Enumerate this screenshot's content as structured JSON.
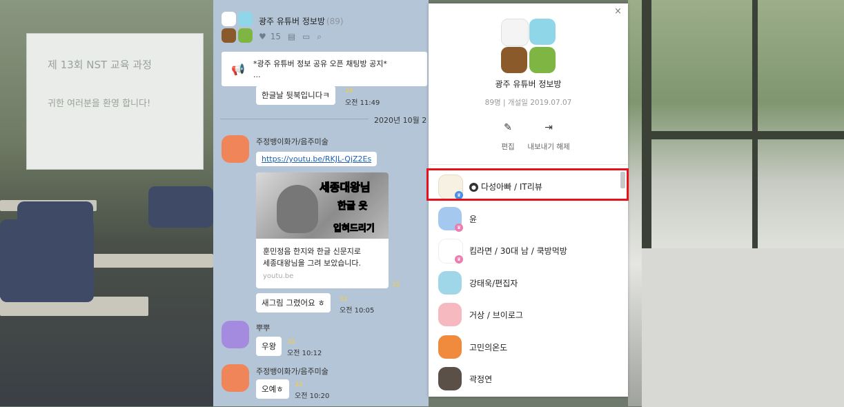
{
  "chat": {
    "room_title": "광주 유튜버 정보방",
    "room_count": "(89)",
    "likes": "15",
    "notice_text": "*광주 유튜버 정보 공유 오픈 채팅방 공지*",
    "notice_more": "...",
    "msg_prev": {
      "text": "한글날 뒷북입니다ㅋ",
      "unread": "24",
      "time": "오전 11:49"
    },
    "date_divider": "2020년 10월 2",
    "msg_link": {
      "sender": "주정뱅이화가/음주미술",
      "url": "https://youtu.be/RKJL-QjZ2Es"
    },
    "card": {
      "img_line1": "세종대왕님",
      "img_line2": "한글 옷",
      "img_line3": "입혀드리기",
      "desc_line1": "훈민정음 한지와 한글 신문지로",
      "desc_line2": "세종대왕님을 그려 보았습니다.",
      "source": "youtu.be",
      "unread": "32"
    },
    "msg_reply": {
      "text": "새그림 그렸어요 ㅎ",
      "unread": "32",
      "time": "오전 10:05"
    },
    "msg_bubu": {
      "sender": "뿌뿌",
      "text": "우왕",
      "unread": "32",
      "time": "오전 10:12"
    },
    "msg_last": {
      "sender": "주정뱅이화가/음주미술",
      "text": "오예ㅎ",
      "unread": "32",
      "time": "오전 10:20"
    }
  },
  "panel": {
    "close": "×",
    "title": "광주 유튜버 정보방",
    "sub": "89명 | 개설일 2019.07.07",
    "action_edit": "편집",
    "action_unpin": "내보내기 해제",
    "members": [
      {
        "name": "다성아빠 / IT리뷰",
        "host": true
      },
      {
        "name": "윤",
        "host": false
      },
      {
        "name": "킴라면 / 30대 남 / 쿡방먹방",
        "host": false
      },
      {
        "name": "강태욱/편집자",
        "host": false
      },
      {
        "name": "거상 / 브이로그",
        "host": false
      },
      {
        "name": "고민의온도",
        "host": false
      },
      {
        "name": "곽정연",
        "host": false
      }
    ]
  },
  "background": {
    "screen_title": "제 13회 NST 교육 과정",
    "screen_line": "귀한 여러분을 환영 합니다!"
  },
  "colors": {
    "chat_bg": "#b3c5d6",
    "highlight": "#e8111b",
    "unread": "#f5d13a"
  }
}
